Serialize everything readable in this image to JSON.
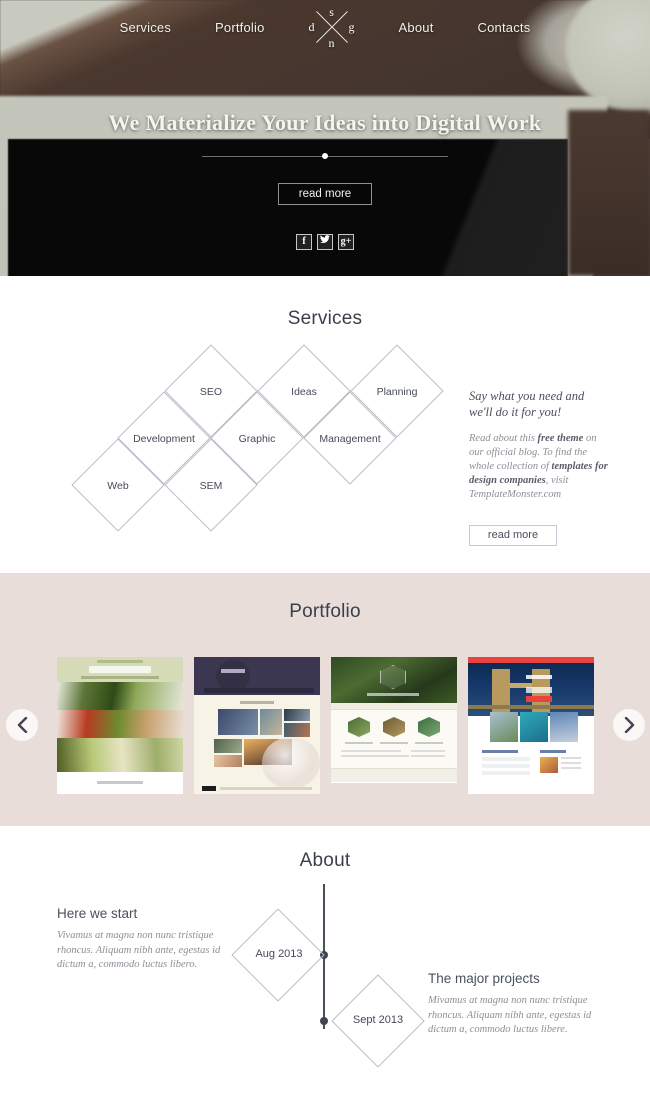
{
  "nav": {
    "left_items": [
      {
        "label": "Services"
      },
      {
        "label": "Portfolio"
      }
    ],
    "right_items": [
      {
        "label": "About"
      },
      {
        "label": "Contacts"
      }
    ],
    "logo": {
      "north": "s",
      "west": "d",
      "east": "g",
      "south": "n"
    }
  },
  "hero": {
    "title": "We Materialize Your Ideas into Digital Work",
    "button": "read more",
    "socials": [
      {
        "name": "facebook-icon",
        "glyph": "f"
      },
      {
        "name": "twitter-icon",
        "glyph": "✉"
      },
      {
        "name": "google-plus-icon",
        "glyph": "g+"
      }
    ]
  },
  "services": {
    "title": "Services",
    "diamonds": [
      {
        "label": "SEO"
      },
      {
        "label": "Ideas"
      },
      {
        "label": "Planning"
      },
      {
        "label": "Development"
      },
      {
        "label": "Graphic"
      },
      {
        "label": "Management"
      },
      {
        "label": "Web"
      },
      {
        "label": "SEM"
      }
    ],
    "lead": "Say what you need and we'll do it for you!",
    "body_1": "Read about this ",
    "body_b1": "free theme",
    "body_2": " on our official blog. To find the whole collection of ",
    "body_b2": "templates for design companies",
    "body_3": ", visit TemplateMonster.com",
    "button": "read more"
  },
  "portfolio": {
    "title": "Portfolio",
    "prev_arrow": "‹",
    "next_arrow": "›",
    "items": [
      {
        "name": "restaurant-template"
      },
      {
        "name": "photography-template"
      },
      {
        "name": "golf-template"
      },
      {
        "name": "travel-template"
      }
    ]
  },
  "about": {
    "title": "About",
    "left": {
      "heading": "Here we start",
      "text": "Vivamus at magna non nunc tristique rhoncus. Aliquam nibh ante, egestas id dictum a, commodo luctus libero."
    },
    "right": {
      "heading": "The major projects",
      "text": "Mivamus at magna non nunc tristique rhoncus. Aliquam nibh ante, egestas id dictum a, commodo luctus libere."
    },
    "milestones": [
      {
        "label": "Aug 2013"
      },
      {
        "label": "Sept 2013"
      }
    ]
  },
  "colors": {
    "portfolio_bg": "#e9ddd9",
    "text_dark": "#3a3f4b",
    "muted": "#8d8f97",
    "line": "#b9bcc6"
  }
}
